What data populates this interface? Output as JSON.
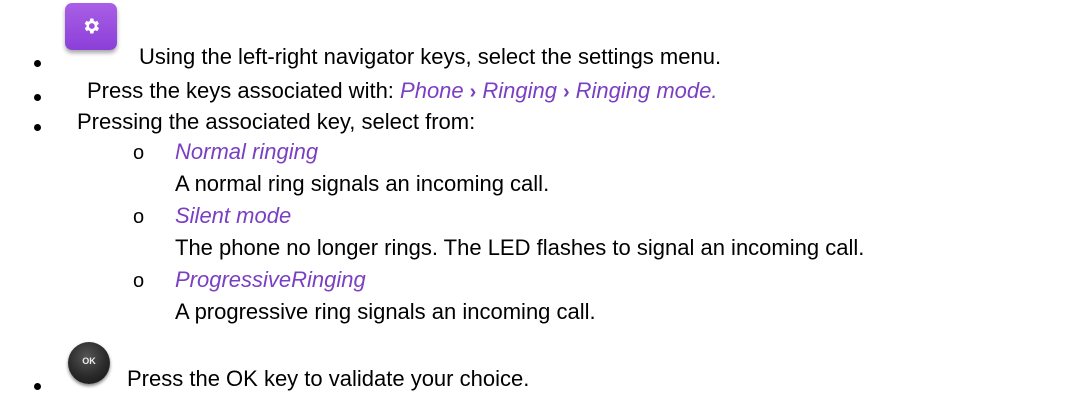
{
  "steps": [
    {
      "text": "Using the left-right navigator keys, select the settings menu."
    },
    {
      "text_prefix": "Press the keys associated with: ",
      "path": [
        "Phone",
        "Ringing",
        "Ringing mode."
      ],
      "separator": "›"
    },
    {
      "text": "Pressing the associated key, select from:"
    },
    {
      "text": "Press the OK key to validate your choice."
    }
  ],
  "options": [
    {
      "bullet": "o",
      "title": "Normal ringing",
      "description": "A normal ring signals an incoming call."
    },
    {
      "bullet": "o",
      "title": "Silent mode",
      "description": "The phone no longer rings. The LED flashes to signal an incoming call."
    },
    {
      "bullet": "o",
      "title": "ProgressiveRinging",
      "description": "A progressive ring signals an incoming call."
    }
  ],
  "icons": {
    "settings": "gear-icon",
    "ok_key": "ok-key-icon",
    "ok_label": "OK"
  },
  "colors": {
    "accent": "#7a3fc2",
    "settings_icon_bg": "#9b4fe0"
  }
}
